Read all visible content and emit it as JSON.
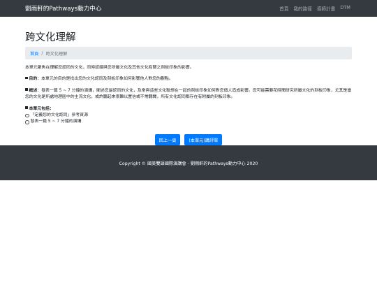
{
  "navbar": {
    "brand": "劉雨軒的Pathways動力中心",
    "links": [
      "首頁",
      "我的路徑",
      "導師計畫",
      "DTM"
    ]
  },
  "page": {
    "title": "跨文化理解"
  },
  "breadcrumb": {
    "home": "首頁",
    "separator": "/",
    "current": "跨文化理解"
  },
  "content": {
    "intro": "本單元聚焦在理解您認同的文化，同時認識與您所屬文化及其他文化有關之刻板印象的影響。",
    "goal_label": "目的",
    "goal_text": "：本單元的目的是找出您的文化認同及刻板印象如何影響他人對您的觀點。",
    "overview_label": "概述",
    "overview_text": "：發表一篇 5 ~ 7 分鐘的演講，闡述您最認同的文化，及常與這些文化聯想在一起的刻板印象如何對您個人造成影響。您可能需要花時間研究所屬文化的刻板印象，尤其是當您的文化是所處地理區中的主流文化，或許聽起來很難以置信或不常聽聞，所有文化認同都存在有附屬的刻板印象。",
    "includes_label": "本單元包括：",
    "items": [
      "「定義您的文化認同」參考資源",
      "發表一篇 5 ~ 7 分鐘的演講"
    ]
  },
  "buttons": {
    "prev": "回上一頁",
    "eval": "(本單元)講評單"
  },
  "footer": {
    "text": "Copyright © 國美雙語國際演講會 - 劉雨軒的Pathways動力中心 2020"
  },
  "colors": {
    "navbar_bg": "#343a40",
    "primary": "#007bff",
    "breadcrumb_bg": "#e9ecef"
  }
}
